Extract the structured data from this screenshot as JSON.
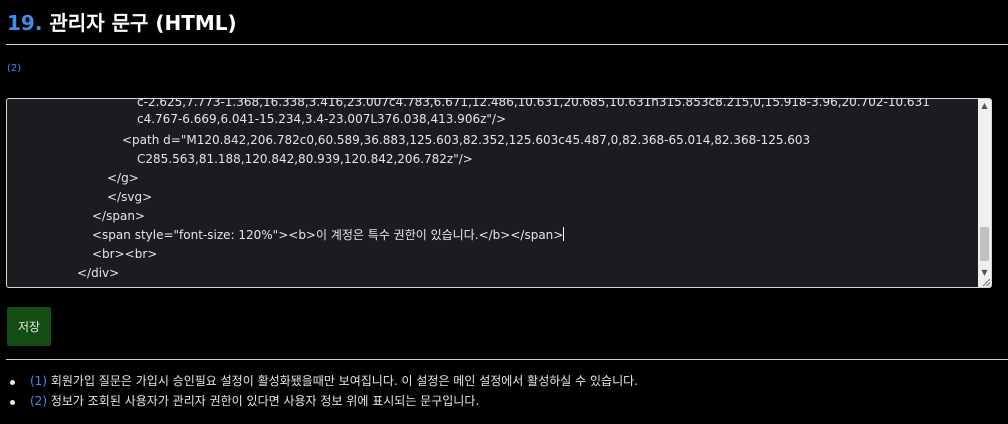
{
  "heading": {
    "number": "19.",
    "title": "관리자 문구 (HTML)"
  },
  "reference_mark": "(2)",
  "editor": {
    "lines": [
      "c-2.625,7.773-1.368,16.338,3.416,23.007c4.783,6.671,12.486,10.631,20.685,10.631h315.853c8.215,0,15.918-3.96,20.702-10.631",
      "c4.767-6.669,6.041-15.234,3.4-23.007L376.038,413.906z\"/>",
      "<path d=\"M120.842,206.782c0,60.589,36.883,125.603,82.352,125.603c45.487,0,82.368-65.014,82.368-125.603",
      "C285.563,81.188,120.842,80.939,120.842,206.782z\"/>",
      "</g>",
      "</svg>",
      "</span>",
      "<span style=\"font-size: 120%\"><b>이 계정은 특수 권한이 있습니다.</b></span>",
      "<br><br>",
      "</div>"
    ]
  },
  "save_button": "저장",
  "notes": [
    {
      "num": "(1)",
      "text": "회원가입 질문은 가입시 승인필요 설정이 활성화됐을때만 보여집니다. 이 설정은 메인 설정에서 활성하실 수 있습니다."
    },
    {
      "num": "(2)",
      "text": "정보가 조회된 사용자가 관리자 권한이 있다면 사용자 정보 위에 표시되는 문구입니다."
    }
  ],
  "icons": {
    "scroll_up": "arrow-up-icon",
    "scroll_down": "arrow-down-icon",
    "resize": "resize-grip-icon"
  }
}
